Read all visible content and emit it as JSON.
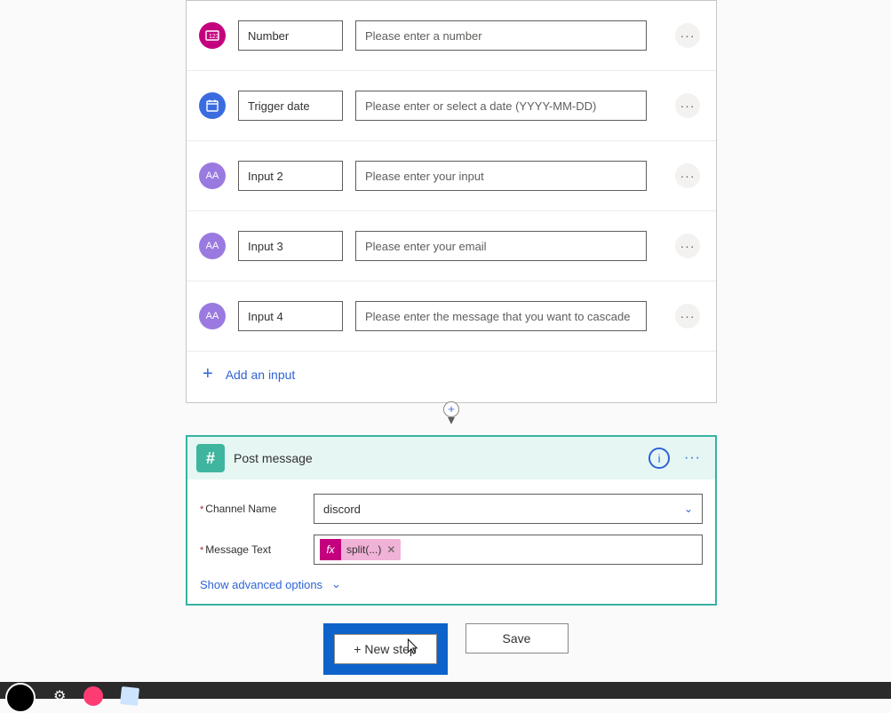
{
  "trigger": {
    "inputs": [
      {
        "icon": "number",
        "name": "Number",
        "placeholder": "Please enter a number"
      },
      {
        "icon": "date",
        "name": "Trigger date",
        "placeholder": "Please enter or select a date (YYYY-MM-DD)"
      },
      {
        "icon": "text",
        "name": "Input 2",
        "placeholder": "Please enter your input"
      },
      {
        "icon": "text",
        "name": "Input 3",
        "placeholder": "Please enter your email"
      },
      {
        "icon": "text",
        "name": "Input 4",
        "placeholder": "Please enter the message that you want to cascade"
      }
    ],
    "add_input_label": "Add an input"
  },
  "action": {
    "title": "Post message",
    "fields": {
      "channel_label": "Channel Name",
      "channel_value": "discord",
      "message_label": "Message Text",
      "message_token": "split(...)"
    },
    "advanced_label": "Show advanced options"
  },
  "footer": {
    "new_step": "+ New step",
    "save": "Save"
  }
}
